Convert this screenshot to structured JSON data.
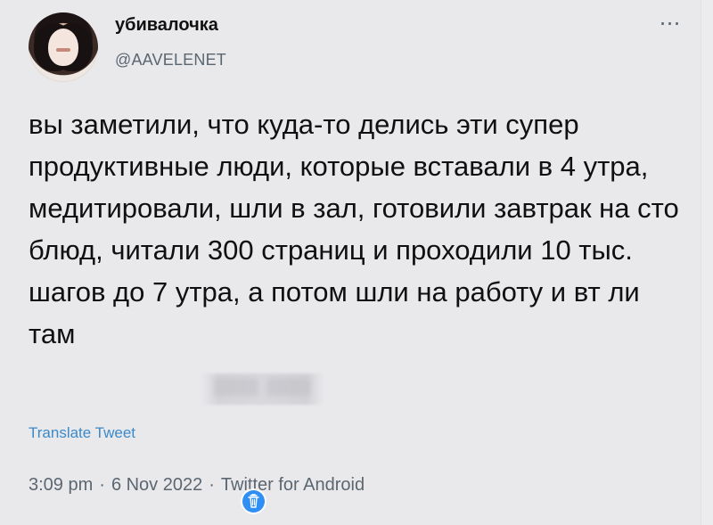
{
  "user": {
    "display_name": "убивалочка",
    "username": "@AAVELENET"
  },
  "tweet": {
    "text": "вы заметили, что куда-то делись эти супер продуктивные люди, которые вставали в 4 утра, медитировали, шли в зал, готовили завтрак на сто блюд, читали 300 страниц и проходили 10 тыс. шагов до 7 утра, а потом шли на работу и вт        ли там",
    "translate_label": "Translate Tweet",
    "time": "3:09 pm",
    "date": "6 Nov 2022",
    "source": "Twitter for Android"
  },
  "icons": {
    "more": "more-icon",
    "avatar": "avatar",
    "trash": "trash-icon"
  },
  "colors": {
    "background": "#e9e9ec",
    "text": "#101010",
    "muted": "#5b6670",
    "link": "#3b89c9",
    "trash": "#2f8ff5"
  }
}
